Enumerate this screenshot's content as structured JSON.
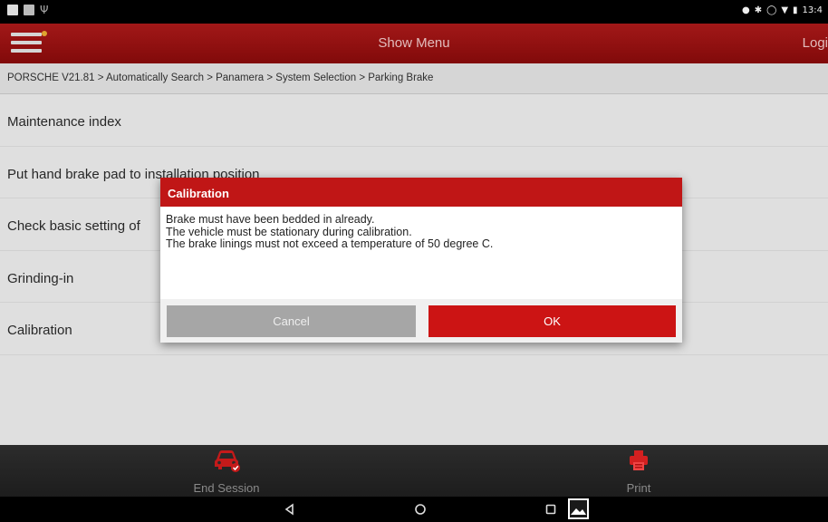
{
  "status_bar": {
    "left_icons": [
      "notification-icon",
      "message-icon",
      "usb-icon"
    ],
    "right_icons": [
      "location-icon",
      "bluetooth-icon",
      "sync-icon",
      "wifi-icon",
      "battery-icon"
    ],
    "time": "13:4"
  },
  "header": {
    "menu_icon": "hamburger-menu-icon",
    "title": "Show Menu",
    "login_label": "Logi"
  },
  "breadcrumb": "PORSCHE V21.81 > Automatically Search > Panamera > System Selection > Parking Brake",
  "menu_items": [
    "Maintenance index",
    "Put hand brake pad to installation position",
    "Check basic setting of",
    "Grinding-in",
    "Calibration"
  ],
  "dialog": {
    "title": "Calibration",
    "lines": [
      "Brake must have been bedded in already.",
      "The vehicle must be stationary during calibration.",
      "The brake linings must not exceed a temperature of 50 degree C."
    ],
    "cancel_label": "Cancel",
    "ok_label": "OK"
  },
  "toolbar": {
    "end_session_label": "End Session",
    "end_session_icon": "car-check-icon",
    "print_label": "Print",
    "print_icon": "printer-icon"
  },
  "navbar": {
    "icons": [
      "back-icon",
      "home-icon",
      "recent-apps-icon",
      "gallery-icon"
    ]
  },
  "colors": {
    "accent": "#c01616",
    "header": "#9e1212",
    "cancel": "#a6a6a6"
  }
}
